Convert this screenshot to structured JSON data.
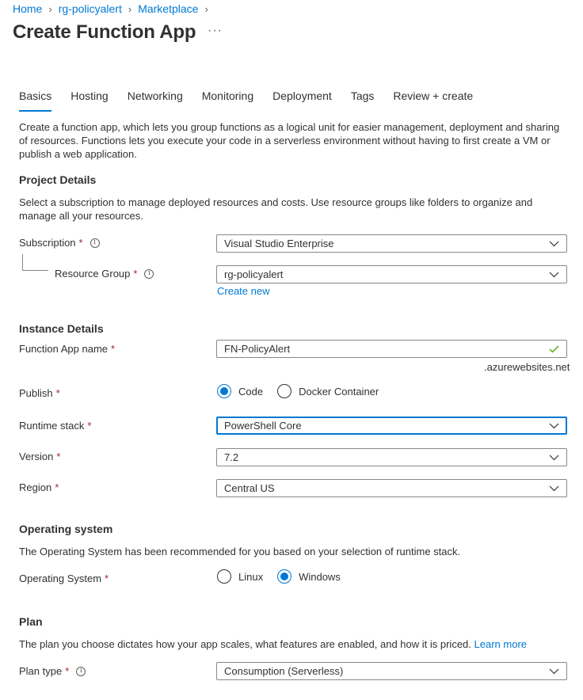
{
  "breadcrumb": [
    "Home",
    "rg-policyalert",
    "Marketplace"
  ],
  "page_title": "Create Function App",
  "more_icon": "ellipsis-icon",
  "more_label": "···",
  "tabs": [
    "Basics",
    "Hosting",
    "Networking",
    "Monitoring",
    "Deployment",
    "Tags",
    "Review + create"
  ],
  "active_tab": "Basics",
  "intro": "Create a function app, which lets you group functions as a logical unit for easier management, deployment and sharing of resources. Functions lets you execute your code in a serverless environment without having to first create a VM or publish a web application.",
  "project": {
    "title": "Project Details",
    "description": "Select a subscription to manage deployed resources and costs. Use resource groups like folders to organize and manage all your resources.",
    "subscription_label": "Subscription",
    "subscription_value": "Visual Studio Enterprise",
    "resource_group_label": "Resource Group",
    "resource_group_value": "rg-policyalert",
    "create_new": "Create new"
  },
  "instance": {
    "title": "Instance Details",
    "name_label": "Function App name",
    "name_value": "FN-PolicyAlert",
    "name_suffix": ".azurewebsites.net",
    "publish_label": "Publish",
    "publish_options": [
      "Code",
      "Docker Container"
    ],
    "publish_selected": "Code",
    "runtime_label": "Runtime stack",
    "runtime_value": "PowerShell Core",
    "version_label": "Version",
    "version_value": "7.2",
    "region_label": "Region",
    "region_value": "Central US"
  },
  "os": {
    "title": "Operating system",
    "description": "The Operating System has been recommended for you based on your selection of runtime stack.",
    "label": "Operating System",
    "options": [
      "Linux",
      "Windows"
    ],
    "selected": "Windows"
  },
  "plan": {
    "title": "Plan",
    "description": "The plan you choose dictates how your app scales, what features are enabled, and how it is priced.",
    "learn_more": "Learn more",
    "label": "Plan type",
    "value": "Consumption (Serverless)"
  },
  "required_marker": "*",
  "info_glyph": "i",
  "colors": {
    "accent": "#0078d4",
    "required": "#a4262c",
    "valid": "#57a300",
    "border": "#8a8886"
  }
}
